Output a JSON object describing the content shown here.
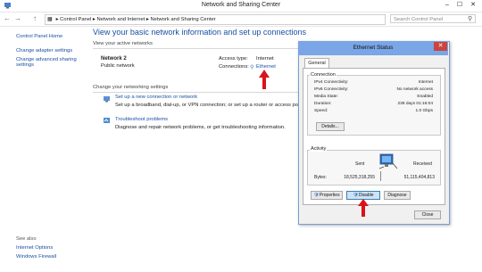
{
  "window": {
    "title": "Network and Sharing Center",
    "min": "–",
    "max": "☐",
    "close": "✕"
  },
  "nav": {
    "back": "←",
    "forward": "→",
    "up": "↑"
  },
  "address": {
    "crumbs": [
      "Control Panel",
      "Network and Internet",
      "Network and Sharing Center"
    ],
    "sep": "▸"
  },
  "search": {
    "placeholder": "Search Control Panel"
  },
  "sidebar": {
    "home": "Control Panel Home",
    "items": [
      "Change adapter settings",
      "Change advanced sharing settings"
    ],
    "see_also_label": "See also",
    "see_also": [
      "Internet Options",
      "Windows Firewall"
    ]
  },
  "main": {
    "heading": "View your basic network information and set up connections",
    "active_label": "View your active networks",
    "network_name": "Network 2",
    "network_type": "Public network",
    "access_type_label": "Access type:",
    "access_type_value": "Internet",
    "connections_label": "Connections:",
    "connections_value": "Ethernet",
    "change_label": "Change your networking settings",
    "tasks": [
      {
        "title": "Set up a new connection or network",
        "desc": "Set up a broadband, dial-up, or VPN connection; or set up a router or access point."
      },
      {
        "title": "Troubleshoot problems",
        "desc": "Diagnose and repair network problems, or get troubleshooting information."
      }
    ]
  },
  "dialog": {
    "title": "Ethernet Status",
    "tab": "General",
    "connection_label": "Connection",
    "rows": [
      {
        "label": "IPv4 Connectivity:",
        "value": "Internet"
      },
      {
        "label": "IPv6 Connectivity:",
        "value": "No network access"
      },
      {
        "label": "Media State:",
        "value": "Enabled"
      },
      {
        "label": "Duration:",
        "value": "238 days 01:16:04"
      },
      {
        "label": "Speed:",
        "value": "1.0 Gbps"
      }
    ],
    "details": "Details...",
    "activity_label": "Activity",
    "sent_label": "Sent",
    "received_label": "Received",
    "bytes_label": "Bytes:",
    "bytes_sent": "18,525,318,255",
    "bytes_received": "51,115,404,813",
    "buttons": {
      "properties": "Properties",
      "disable": "Disable",
      "diagnose": "Diagnose",
      "close": "Close"
    }
  },
  "colors": {
    "link": "#1a4fa3",
    "dialog_title": "#7aa5e6",
    "annotation": "#d8141b"
  }
}
